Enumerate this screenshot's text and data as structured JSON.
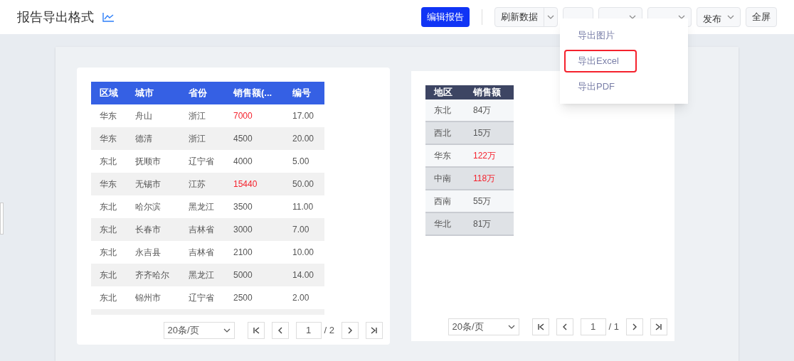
{
  "title": "报告导出格式",
  "toolbar": {
    "edit_button": "编辑报告",
    "buttons": [
      {
        "label": "刷新数据",
        "kind": "split"
      },
      {
        "kind": "plain"
      },
      {
        "kind": "dropdown"
      },
      {
        "kind": "dropdown"
      },
      {
        "label": "发布",
        "kind": "dropdown"
      },
      {
        "label": "全屏",
        "kind": "plain"
      }
    ]
  },
  "export_menu": [
    {
      "label": "导出图片",
      "selected": false
    },
    {
      "label": "导出Excel",
      "selected": true
    },
    {
      "label": "导出PDF",
      "selected": false
    }
  ],
  "table_1": {
    "columns": [
      "区域",
      "城市",
      "省份",
      "销售额(...",
      "编号"
    ],
    "rows": [
      {
        "cells": [
          "华东",
          "舟山",
          "浙江",
          "7000",
          "17.00"
        ],
        "highlight": true
      },
      {
        "cells": [
          "华东",
          "德清",
          "浙江",
          "4500",
          "20.00"
        ],
        "highlight": false
      },
      {
        "cells": [
          "东北",
          "抚顺市",
          "辽宁省",
          "4000",
          "5.00"
        ],
        "highlight": false
      },
      {
        "cells": [
          "华东",
          "无锡市",
          "江苏",
          "15440",
          "50.00"
        ],
        "highlight": true
      },
      {
        "cells": [
          "东北",
          "哈尔滨",
          "黑龙江",
          "3500",
          "11.00"
        ],
        "highlight": false
      },
      {
        "cells": [
          "东北",
          "长春市",
          "吉林省",
          "3000",
          "7.00"
        ],
        "highlight": false
      },
      {
        "cells": [
          "东北",
          "永吉县",
          "吉林省",
          "2100",
          "10.00"
        ],
        "highlight": false
      },
      {
        "cells": [
          "东北",
          "齐齐哈尔",
          "黑龙江",
          "5000",
          "14.00"
        ],
        "highlight": false
      },
      {
        "cells": [
          "东北",
          "锦州市",
          "辽宁省",
          "2500",
          "2.00"
        ],
        "highlight": false
      }
    ],
    "pagination": {
      "page_size": "20条/页",
      "page": "1",
      "total": "/ 2"
    }
  },
  "table_2": {
    "columns": [
      "地区",
      "销售额"
    ],
    "rows": [
      {
        "cells": [
          "东北",
          "84万"
        ],
        "highlight": false
      },
      {
        "cells": [
          "西北",
          "15万"
        ],
        "highlight": false
      },
      {
        "cells": [
          "华东",
          "122万"
        ],
        "highlight": true
      },
      {
        "cells": [
          "中南",
          "118万"
        ],
        "highlight": true
      },
      {
        "cells": [
          "西南",
          "55万"
        ],
        "highlight": false
      },
      {
        "cells": [
          "华北",
          "81万"
        ],
        "highlight": false
      }
    ],
    "pagination": {
      "page_size": "20条/页",
      "page": "1",
      "total": "/ 1"
    }
  }
}
